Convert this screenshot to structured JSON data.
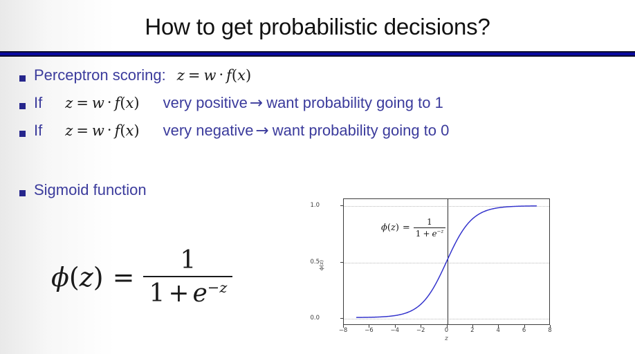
{
  "slide": {
    "title": "How to get probabilistic decisions?",
    "accent_color": "#0a0aa0",
    "bullet_text_color": "#3b3b9c",
    "bullet_marker_color": "#26268c",
    "title_color": "#111111"
  },
  "bullets": [
    {
      "label": "Perceptron scoring:",
      "math": {
        "lhs": "z",
        "eq": "=",
        "w": "w",
        "cdot": "·",
        "f": "f",
        "open": "(",
        "arg": "x",
        "close": ")"
      },
      "trailing": "",
      "arrow": ""
    },
    {
      "label": "If",
      "math": {
        "lhs": "z",
        "eq": "=",
        "w": "w",
        "cdot": "·",
        "f": "f",
        "open": "(",
        "arg": "x",
        "close": ")"
      },
      "condition": "very positive",
      "arrow": "→",
      "trailing": "want probability going to 1"
    },
    {
      "label": "If",
      "math": {
        "lhs": "z",
        "eq": "=",
        "w": "w",
        "cdot": "·",
        "f": "f",
        "open": "(",
        "arg": "x",
        "close": ")"
      },
      "condition": "very negative",
      "arrow": "→",
      "trailing": "want probability going to 0"
    },
    {
      "label": "Sigmoid function",
      "trailing": "",
      "arrow": ""
    }
  ],
  "formula": {
    "phi": "ϕ",
    "open": "(",
    "var": "z",
    "close": ")",
    "eq": "=",
    "numerator": "1",
    "denom_one": "1",
    "denom_plus": "+",
    "denom_e": "e",
    "denom_minus": "−",
    "denom_z": "z"
  },
  "chart_data": {
    "type": "line",
    "title": "",
    "xlabel": "z",
    "ylabel": "ϕ(z)",
    "annotation": "ϕ(z) = 1 / (1 + e^-z)",
    "xlim": [
      -8,
      8
    ],
    "ylim": [
      -0.06,
      1.06
    ],
    "xticks": [
      -8,
      -6,
      -4,
      -2,
      0,
      2,
      4,
      6,
      8
    ],
    "xticklabels": [
      "−8",
      "−6",
      "−4",
      "−2",
      "0",
      "2",
      "4",
      "6",
      "8"
    ],
    "yticks": [
      0.0,
      0.5,
      1.0
    ],
    "yticklabels": [
      "0.0",
      "0.5",
      "1.0"
    ],
    "grid": "dotted-horizontal",
    "legend": "none",
    "vline_at_x": 0,
    "series": [
      {
        "name": "sigmoid",
        "color": "#3333cc",
        "linewidth": 1.5,
        "x_range": [
          -7,
          7
        ],
        "x": [
          -7,
          -6.5,
          -6,
          -5.5,
          -5,
          -4.5,
          -4,
          -3.5,
          -3,
          -2.5,
          -2,
          -1.5,
          -1,
          -0.5,
          0,
          0.5,
          1,
          1.5,
          2,
          2.5,
          3,
          3.5,
          4,
          4.5,
          5,
          5.5,
          6,
          6.5,
          7
        ],
        "values": [
          0.0009,
          0.0015,
          0.0025,
          0.0041,
          0.0067,
          0.011,
          0.018,
          0.0293,
          0.0474,
          0.0759,
          0.1192,
          0.1824,
          0.2689,
          0.3775,
          0.5,
          0.6225,
          0.7311,
          0.8176,
          0.8808,
          0.9241,
          0.9526,
          0.9707,
          0.982,
          0.989,
          0.9933,
          0.9959,
          0.9975,
          0.9985,
          0.9991
        ]
      }
    ]
  }
}
